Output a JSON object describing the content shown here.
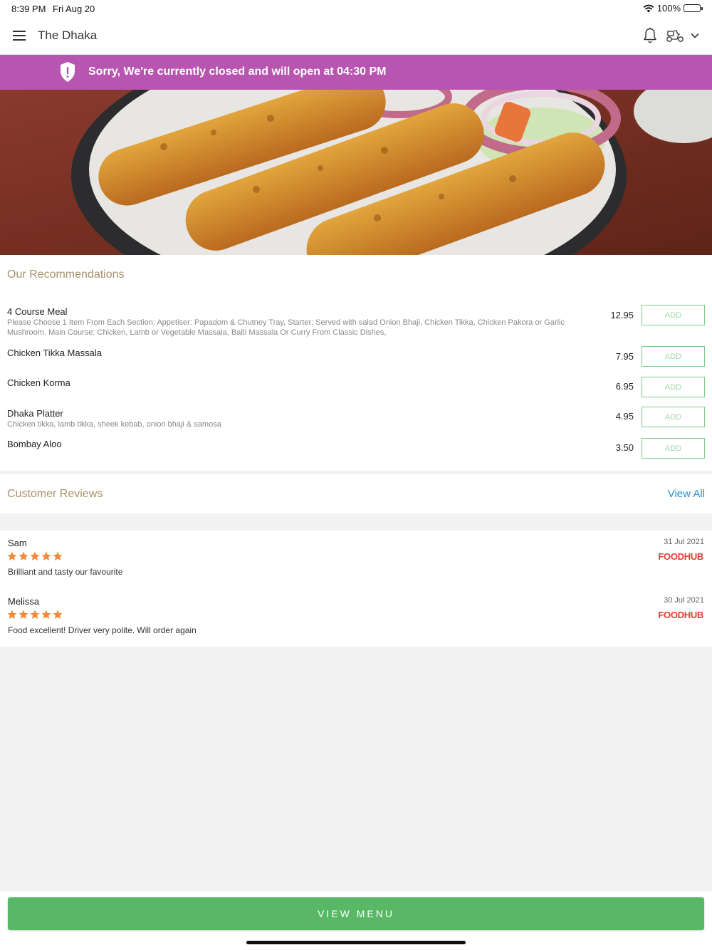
{
  "status_bar": {
    "time": "8:39 PM",
    "date": "Fri Aug 20",
    "battery": "100%"
  },
  "header": {
    "title": "The Dhaka",
    "icons": [
      "menu-icon",
      "bell-icon",
      "scooter-icon",
      "chevron-down-icon"
    ]
  },
  "banner": {
    "text": "Sorry, We're currently closed and will open at 04:30 PM",
    "color": "#b855b0"
  },
  "recommendations": {
    "title": "Our Recommendations",
    "items": [
      {
        "name": "4 Course Meal",
        "description": "Please Choose 1 Item From Each Section: Appetiser: Papadom & Chutney Tray, Starter: Served with salad Onion Bhaji, Chicken Tikka, Chicken Pakora or Garlic Mushroom. Main Course: Chicken, Lamb or Vegetable Massala, Balti Massala Or Curry From Classic Dishes,",
        "price": "12.95",
        "add_label": "ADD"
      },
      {
        "name": "Chicken Tikka Massala",
        "description": "",
        "price": "7.95",
        "add_label": "ADD"
      },
      {
        "name": "Chicken Korma",
        "description": "",
        "price": "6.95",
        "add_label": "ADD"
      },
      {
        "name": "Dhaka Platter",
        "description": "Chicken tikka, lamb tikka, sheek kebab, onion bhaji & samosa",
        "price": "4.95",
        "add_label": "ADD"
      },
      {
        "name": "Bombay Aloo",
        "description": "",
        "price": "3.50",
        "add_label": "ADD"
      }
    ]
  },
  "reviews": {
    "title": "Customer Reviews",
    "view_all": "View All",
    "items": [
      {
        "name": "Sam",
        "rating": 5,
        "text": "Brilliant and tasty our favourite",
        "date": "31 Jul 2021",
        "source": "FOODHUB"
      },
      {
        "name": "Melissa",
        "rating": 5,
        "text": "Food excellent! Driver very polite. Will order again",
        "date": "30 Jul 2021",
        "source": "FOODHUB"
      }
    ]
  },
  "footer": {
    "button_label": "VIEW MENU",
    "color": "#58b866"
  }
}
